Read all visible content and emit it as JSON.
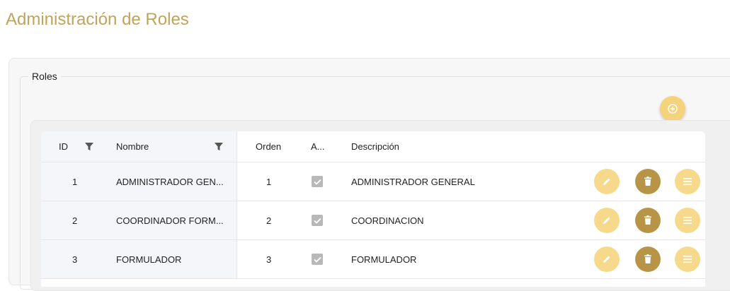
{
  "page": {
    "title": "Administración de Roles"
  },
  "section": {
    "legend": "Roles"
  },
  "table": {
    "headers": {
      "id": "ID",
      "name": "Nombre",
      "order": "Orden",
      "active": "A...",
      "description": "Descripción"
    },
    "rows": [
      {
        "id": "1",
        "name": "ADMINISTRADOR GEN...",
        "order": "1",
        "active": true,
        "description": "ADMINISTRADOR GENERAL"
      },
      {
        "id": "2",
        "name": "COORDINADOR FORM...",
        "order": "2",
        "active": true,
        "description": "COORDINACION"
      },
      {
        "id": "3",
        "name": "FORMULADOR",
        "order": "3",
        "active": true,
        "description": "FORMULADOR"
      }
    ]
  },
  "colors": {
    "accent": "#c2a35a",
    "button_light": "#f6d98a",
    "button_dark": "#b89446"
  },
  "icons": {
    "add": "add-circle-icon",
    "filter": "filter-icon",
    "edit": "pencil-icon",
    "delete": "trash-icon",
    "detail": "menu-lines-icon",
    "check": "checkmark-icon"
  }
}
